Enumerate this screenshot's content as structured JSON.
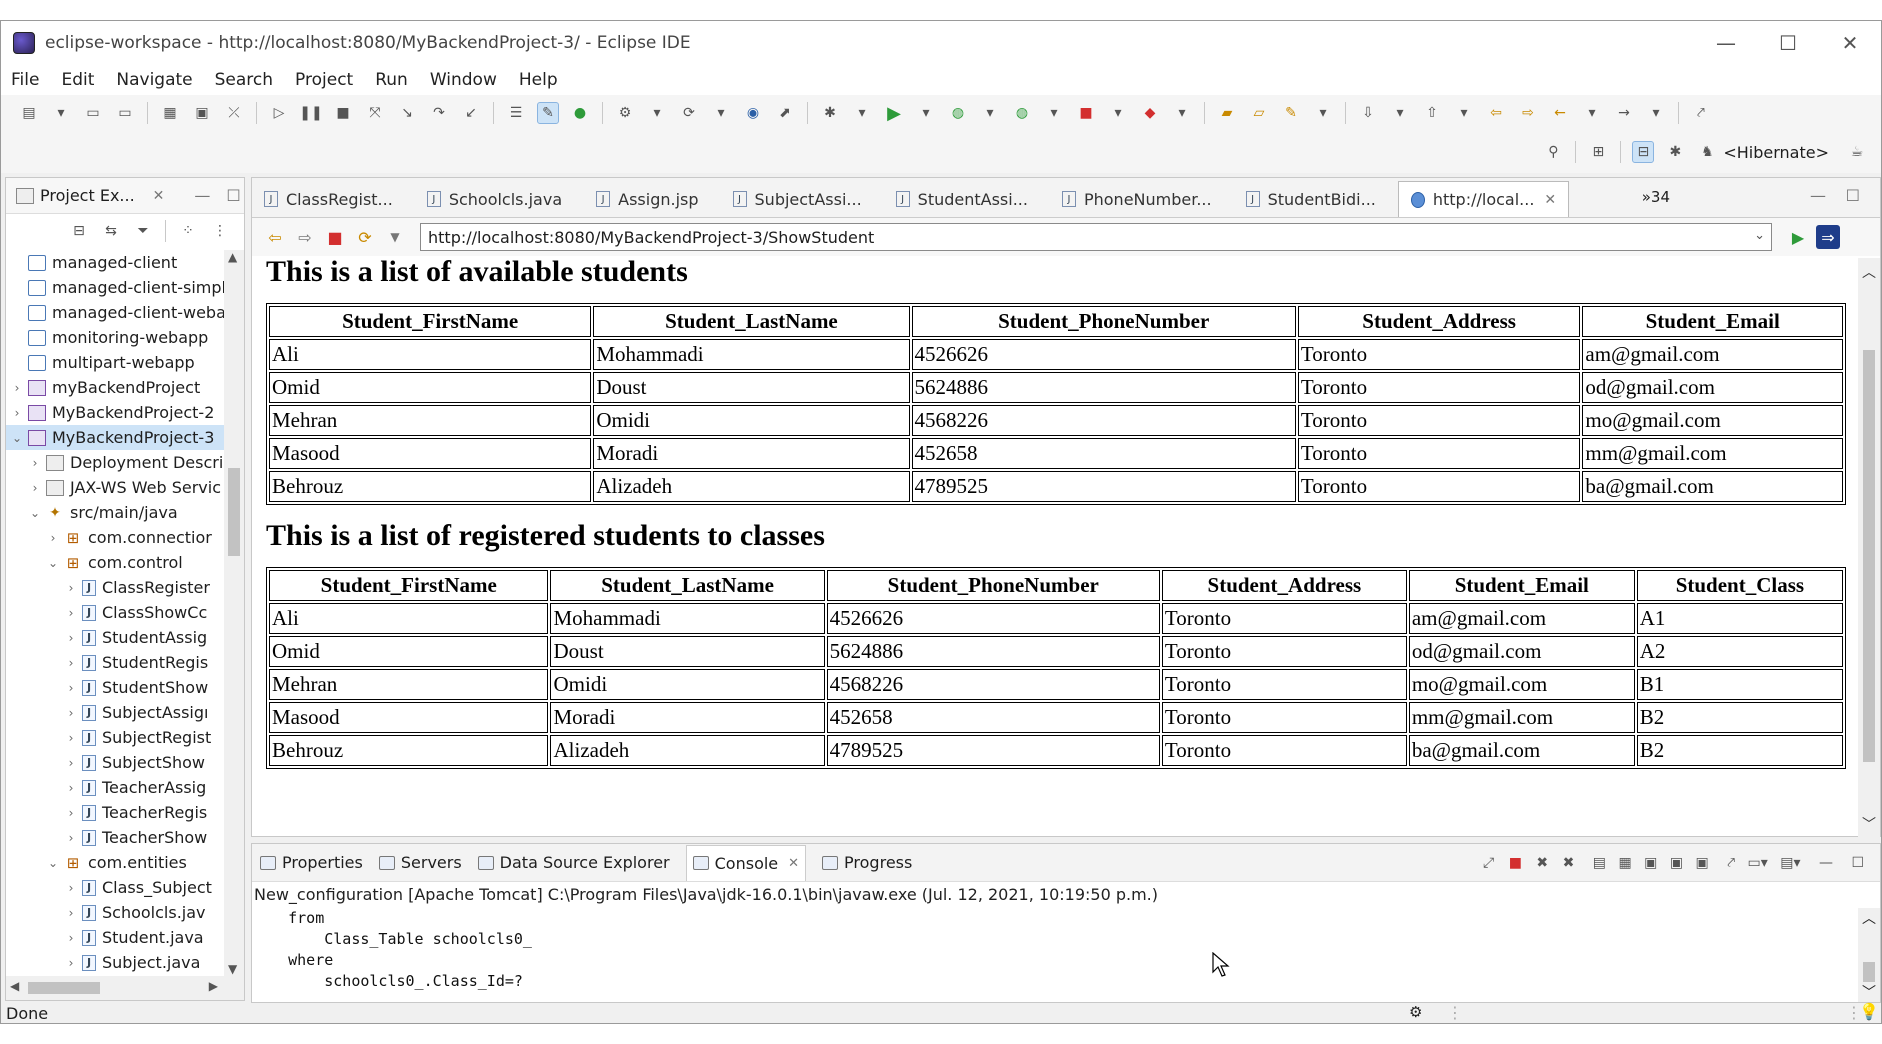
{
  "window": {
    "title": "eclipse-workspace - http://localhost:8080/MyBackendProject-3/ - Eclipse IDE",
    "min": "—",
    "max": "☐",
    "close": "✕"
  },
  "menu": [
    "File",
    "Edit",
    "Navigate",
    "Search",
    "Project",
    "Run",
    "Window",
    "Help"
  ],
  "perspective": "<Hibernate>",
  "explorer": {
    "title": "Project Ex...",
    "items": [
      {
        "label": "managed-client",
        "level": 0,
        "twisty": "",
        "icon": "folder"
      },
      {
        "label": "managed-client-simpl",
        "level": 0,
        "twisty": "",
        "icon": "folder"
      },
      {
        "label": "managed-client-weba",
        "level": 0,
        "twisty": "",
        "icon": "folder"
      },
      {
        "label": "monitoring-webapp",
        "level": 0,
        "twisty": "",
        "icon": "folder"
      },
      {
        "label": "multipart-webapp",
        "level": 0,
        "twisty": "",
        "icon": "folder"
      },
      {
        "label": "myBackendProject",
        "level": 0,
        "twisty": ">",
        "icon": "proj"
      },
      {
        "label": "MyBackendProject-2",
        "level": 0,
        "twisty": ">",
        "icon": "proj"
      },
      {
        "label": "MyBackendProject-3",
        "level": 0,
        "twisty": "v",
        "icon": "proj",
        "selected": true
      },
      {
        "label": "Deployment Descri",
        "level": 1,
        "twisty": ">",
        "icon": "misc"
      },
      {
        "label": "JAX-WS Web Servic",
        "level": 1,
        "twisty": ">",
        "icon": "misc"
      },
      {
        "label": "src/main/java",
        "level": 1,
        "twisty": "v",
        "icon": "src"
      },
      {
        "label": "com.connectior",
        "level": 2,
        "twisty": ">",
        "icon": "pkg"
      },
      {
        "label": "com.control",
        "level": 2,
        "twisty": "v",
        "icon": "pkg"
      },
      {
        "label": "ClassRegister",
        "level": 3,
        "twisty": ">",
        "icon": "jfile"
      },
      {
        "label": "ClassShowCc",
        "level": 3,
        "twisty": ">",
        "icon": "jfile"
      },
      {
        "label": "StudentAssig",
        "level": 3,
        "twisty": ">",
        "icon": "jfile"
      },
      {
        "label": "StudentRegis",
        "level": 3,
        "twisty": ">",
        "icon": "jfile"
      },
      {
        "label": "StudentShow",
        "level": 3,
        "twisty": ">",
        "icon": "jfile"
      },
      {
        "label": "SubjectAssigı",
        "level": 3,
        "twisty": ">",
        "icon": "jfile"
      },
      {
        "label": "SubjectRegist",
        "level": 3,
        "twisty": ">",
        "icon": "jfile"
      },
      {
        "label": "SubjectShow",
        "level": 3,
        "twisty": ">",
        "icon": "jfile"
      },
      {
        "label": "TeacherAssig",
        "level": 3,
        "twisty": ">",
        "icon": "jfile"
      },
      {
        "label": "TeacherRegis",
        "level": 3,
        "twisty": ">",
        "icon": "jfile"
      },
      {
        "label": "TeacherShow",
        "level": 3,
        "twisty": ">",
        "icon": "jfile"
      },
      {
        "label": "com.entities",
        "level": 2,
        "twisty": "v",
        "icon": "pkg"
      },
      {
        "label": "Class_Subject",
        "level": 3,
        "twisty": ">",
        "icon": "jfile"
      },
      {
        "label": "Schoolcls.jav",
        "level": 3,
        "twisty": ">",
        "icon": "jfile"
      },
      {
        "label": "Student.java",
        "level": 3,
        "twisty": ">",
        "icon": "jfile"
      },
      {
        "label": "Subject.java",
        "level": 3,
        "twisty": ">",
        "icon": "jfile"
      }
    ]
  },
  "editor_tabs": [
    {
      "label": "ClassRegist..."
    },
    {
      "label": "Schoolcls.java"
    },
    {
      "label": "Assign.jsp"
    },
    {
      "label": "SubjectAssi..."
    },
    {
      "label": "StudentAssi..."
    },
    {
      "label": "PhoneNumber..."
    },
    {
      "label": "StudentBidi..."
    },
    {
      "label": "http://local...",
      "active": true
    }
  ],
  "overflow_tabs": "»34",
  "browser": {
    "url": "http://localhost:8080/MyBackendProject-3/ShowStudent"
  },
  "page": {
    "heading1": "This is a list of available students",
    "table1": {
      "headers": [
        "Student_FirstName",
        "Student_LastName",
        "Student_PhoneNumber",
        "Student_Address",
        "Student_Email"
      ],
      "rows": [
        [
          "Ali",
          "Mohammadi",
          "4526626",
          "Toronto",
          "am@gmail.com"
        ],
        [
          "Omid",
          "Doust",
          "5624886",
          "Toronto",
          "od@gmail.com"
        ],
        [
          "Mehran",
          "Omidi",
          "4568226",
          "Toronto",
          "mo@gmail.com"
        ],
        [
          "Masood",
          "Moradi",
          "452658",
          "Toronto",
          "mm@gmail.com"
        ],
        [
          "Behrouz",
          "Alizadeh",
          "4789525",
          "Toronto",
          "ba@gmail.com"
        ]
      ]
    },
    "heading2": "This is a list of registered students to classes",
    "table2": {
      "headers": [
        "Student_FirstName",
        "Student_LastName",
        "Student_PhoneNumber",
        "Student_Address",
        "Student_Email",
        "Student_Class"
      ],
      "rows": [
        [
          "Ali",
          "Mohammadi",
          "4526626",
          "Toronto",
          "am@gmail.com",
          "A1"
        ],
        [
          "Omid",
          "Doust",
          "5624886",
          "Toronto",
          "od@gmail.com",
          "A2"
        ],
        [
          "Mehran",
          "Omidi",
          "4568226",
          "Toronto",
          "mo@gmail.com",
          "B1"
        ],
        [
          "Masood",
          "Moradi",
          "452658",
          "Toronto",
          "mm@gmail.com",
          "B2"
        ],
        [
          "Behrouz",
          "Alizadeh",
          "4789525",
          "Toronto",
          "ba@gmail.com",
          "B2"
        ]
      ]
    }
  },
  "bottom_tabs": [
    {
      "label": "Properties"
    },
    {
      "label": "Servers"
    },
    {
      "label": "Data Source Explorer"
    },
    {
      "label": "Console",
      "active": true
    },
    {
      "label": "Progress"
    }
  ],
  "console": {
    "config": "New_configuration [Apache Tomcat] C:\\Program Files\\Java\\jdk-16.0.1\\bin\\javaw.exe  (Jul. 12, 2021, 10:19:50 p.m.)",
    "lines": [
      "    from",
      "        Class_Table schoolcls0_",
      "    where",
      "        schoolcls0_.Class_Id=?"
    ]
  },
  "status": "Done",
  "colors": {
    "accent": "#cde3f7",
    "stop": "#d32f2f",
    "run": "#2e9b3a"
  }
}
